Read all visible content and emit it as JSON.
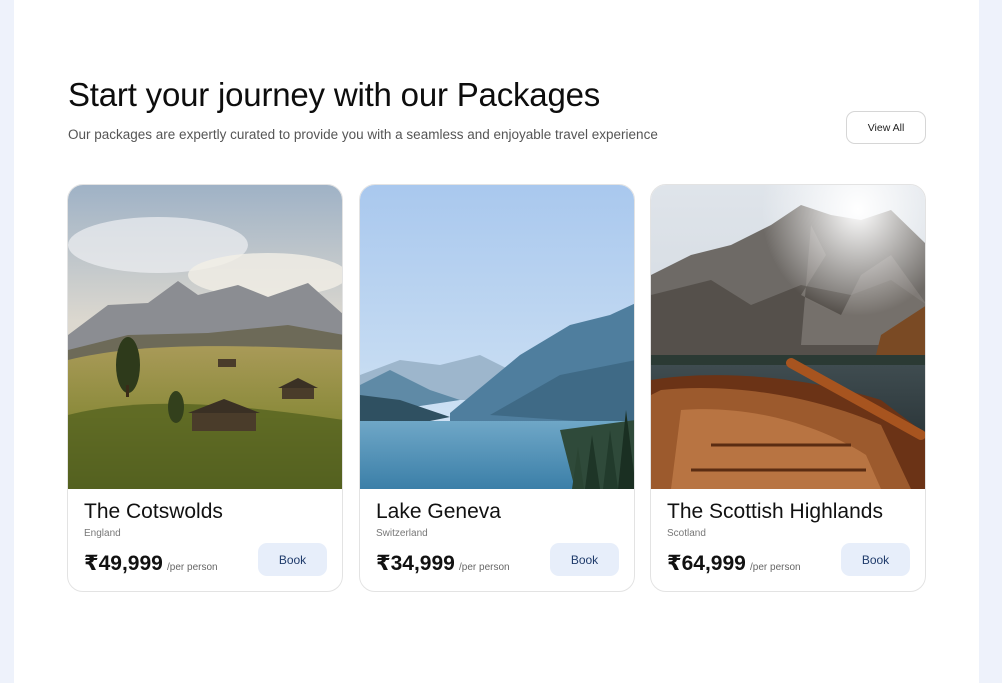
{
  "section": {
    "title": "Start your journey with our Packages",
    "subtitle": "Our packages are expertly curated to provide you with a seamless and enjoyable travel experience",
    "view_all_label": "View All"
  },
  "packages": [
    {
      "name": "The Cotswolds",
      "country": "England",
      "price": "₹49,999",
      "per": "/per person",
      "book_label": "Book"
    },
    {
      "name": "Lake Geneva",
      "country": "Switzerland",
      "price": "₹34,999",
      "per": "/per person",
      "book_label": "Book"
    },
    {
      "name": "The Scottish Highlands",
      "country": "Scotland",
      "price": "₹64,999",
      "per": "/per person",
      "book_label": "Book"
    }
  ],
  "colors": {
    "background": "#eef2fb",
    "card_border": "#e3e3e3",
    "book_button_bg": "#e7eefa",
    "book_button_text": "#1f3b6b"
  }
}
